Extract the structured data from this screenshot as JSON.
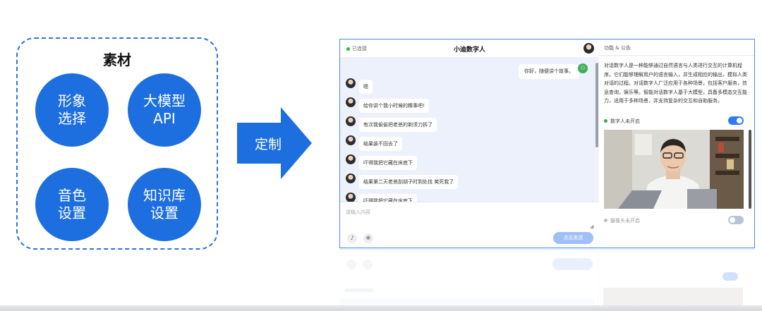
{
  "materials": {
    "title": "素材",
    "items": [
      "形象\n选择",
      "大模型\nAPI",
      "音色\n设置",
      "知识库\n设置"
    ]
  },
  "arrow": {
    "label": "定制"
  },
  "chat": {
    "status": "已连接",
    "title": "小迪数字人",
    "user_message": "你好，随便讲个故事。",
    "bot_messages": [
      "嗯",
      "给你讲个我小时候的糗事吧!",
      "有次我偷偷把老爸的剃须刀拆了",
      "结果装不回去了",
      "吓得我把它藏在床底下",
      "结果第二天老爸刮胡子时到处找 笑死我了",
      "吓得我把它藏在床底下"
    ],
    "input_placeholder": "请输入内容",
    "mic_icon": "mic-icon",
    "settings_icon": "gear-icon",
    "send_label": "点击发送"
  },
  "side": {
    "header": "功能 & 公告",
    "intro": "对话数字人是一种能够通过自然语言与人类进行交互的计算机程序。它们能够理解用户的语言输入，并生成相应的输出，模拟人类对话的过程。对话数字人广泛应用于各种场景，包括客户服务，信息查询，娱乐等。智能对话数字人基于大模型，具备多模态交互能力，适用于多种场景，并支持复杂的交互和自助服务。",
    "digital_status": "数字人未开启",
    "camera_status": "摄像头未开启",
    "colors": {
      "accent": "#1d6fe0",
      "toggle_on": "#2f7cf0",
      "toggle_off": "#b9c3d6",
      "online": "#36b04a"
    }
  }
}
